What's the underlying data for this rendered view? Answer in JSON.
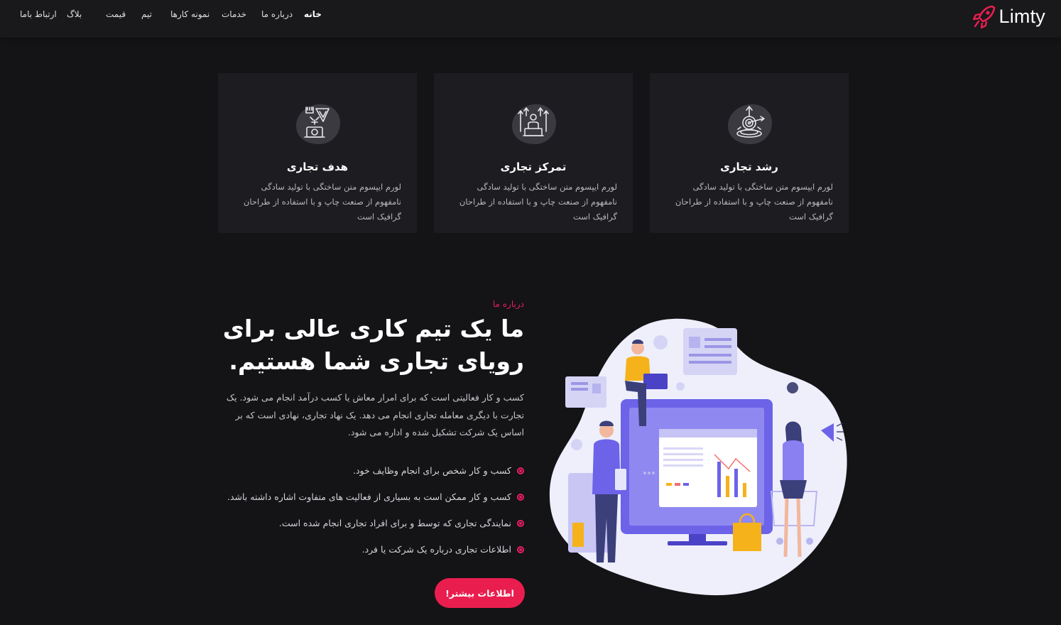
{
  "brand": {
    "name": "Limty",
    "accent": "#e91e4f"
  },
  "nav": {
    "items": [
      {
        "label": "خانه",
        "active": true
      },
      {
        "label": "درباره ما"
      },
      {
        "label": "خدمات"
      },
      {
        "label": "نمونه کارها"
      },
      {
        "label": "تیم"
      },
      {
        "label": "قیمت"
      },
      {
        "label": "بلاگ"
      },
      {
        "label": "ارتباط باما"
      }
    ]
  },
  "features": [
    {
      "icon": "growth-target-icon",
      "title": "رشد تجاری",
      "text": "لورم ایپسوم متن ساختگی با تولید سادگی نامفهوم از صنعت چاپ و با استفاده از طراحان گرافیک است"
    },
    {
      "icon": "team-focus-icon",
      "title": "تمرکز تجاری",
      "text": "لورم ایپسوم متن ساختگی با تولید سادگی نامفهوم از صنعت چاپ و با استفاده از طراحان گرافیک است"
    },
    {
      "icon": "business-goal-icon",
      "title": "هدف تجاری",
      "text": "لورم ایپسوم متن ساختگی با تولید سادگی نامفهوم از صنعت چاپ و با استفاده از طراحان گرافیک است"
    }
  ],
  "about": {
    "kicker": "درباره ما",
    "title": "ما یک تیم کاری عالی برای رویای تجاری شما هستیم.",
    "description": "کسب و کار فعالیتی است که برای امرار معاش یا کسب درآمد انجام می شود. یک تجارت با دیگری معامله تجاری انجام می دهد. یک نهاد تجاری، نهادی است که بر اساس یک شرکت تشکیل شده و اداره می شود.",
    "points": [
      "کسب و کار شخص برای انجام وظایف خود.",
      "کسب و کار ممکن است به بسیاری از فعالیت های متفاوت اشاره داشته باشد.",
      "نمایندگی تجاری که توسط و برای افراد تجاری انجام شده است.",
      "اطلاعات تجاری درباره یک شرکت یا فرد."
    ],
    "cta_label": "اطلاعات بیشتر!"
  }
}
